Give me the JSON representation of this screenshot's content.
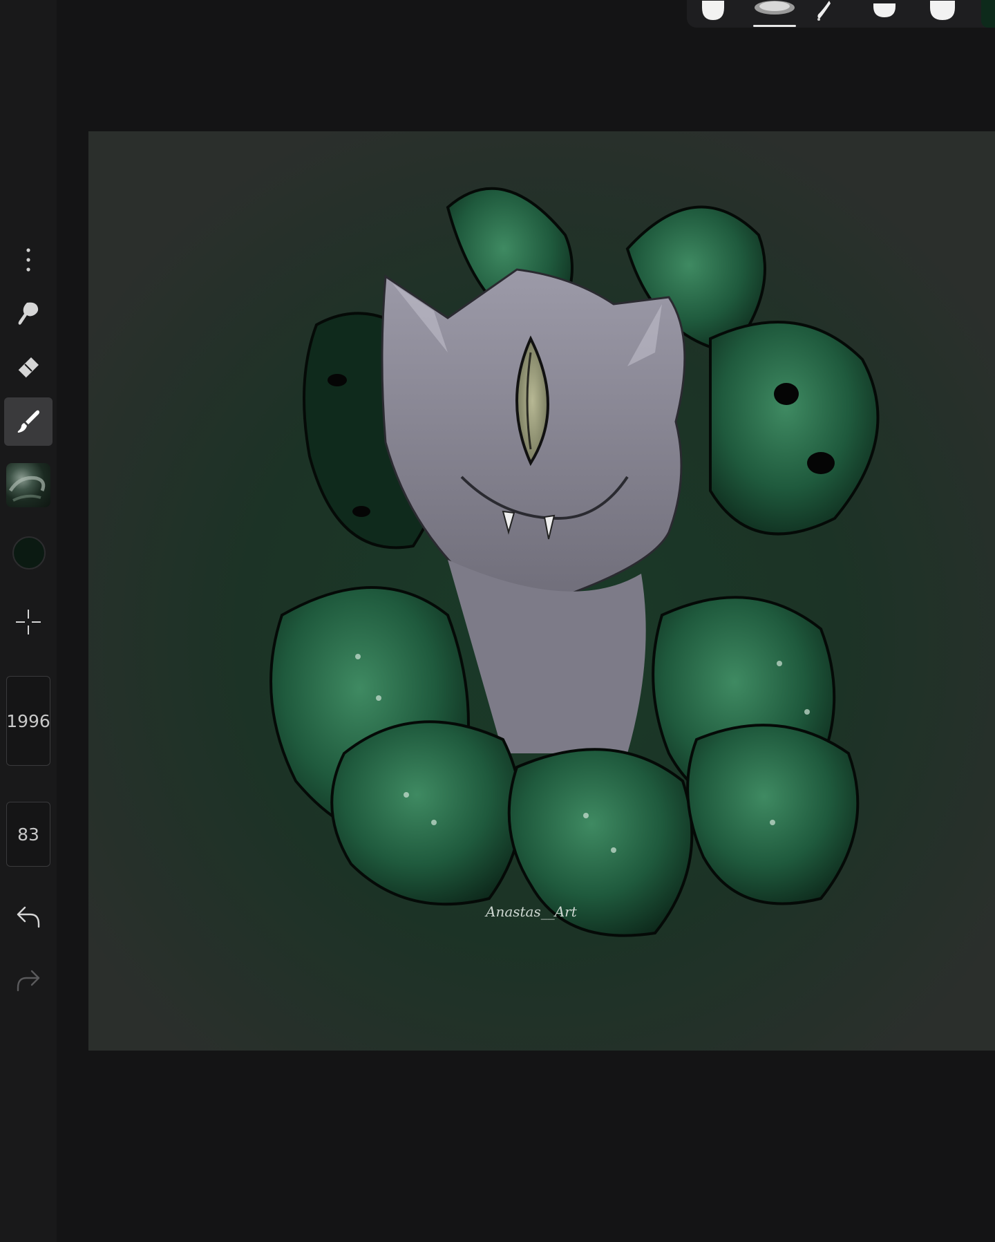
{
  "toolbar": {
    "brush_size": "1996",
    "opacity": "83"
  },
  "icons": {
    "more": "more-vertical-icon",
    "smudge": "smudge-icon",
    "eraser": "eraser-icon",
    "brush": "brush-icon",
    "texture": "texture-swatch-icon",
    "color": "color-swatch-icon",
    "transform": "crosshair-move-icon",
    "undo": "undo-icon",
    "redo": "redo-icon"
  },
  "colors": {
    "background": "#141415",
    "toolbar": "#19191a",
    "active_tool": "#3a3a3c",
    "current_color": "#0b1a12",
    "accent_underline": "#e8e8e8"
  },
  "artwork": {
    "signature": "Anastas__Art"
  }
}
